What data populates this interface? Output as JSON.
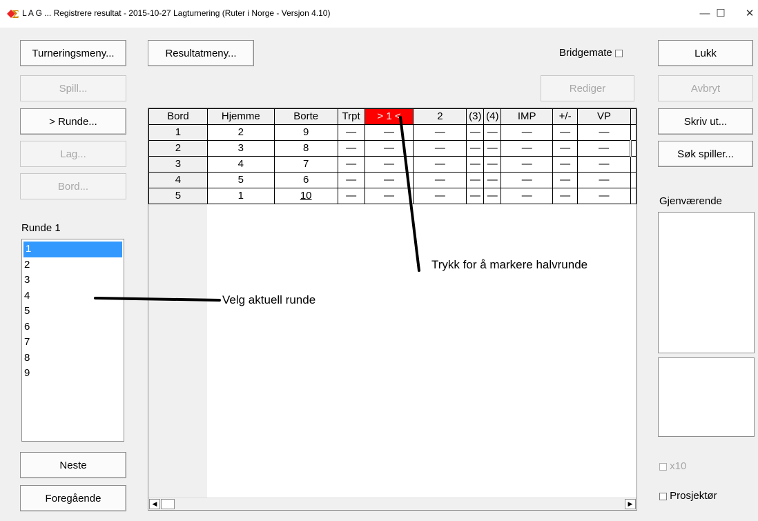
{
  "window": {
    "title": "L A G ... Registrere resultat - 2015-10-27  Lagturnering  (Ruter i Norge - Versjon 4.10)",
    "controls": {
      "minimize": "—",
      "maximize": "☐",
      "close": "✕"
    }
  },
  "toolbar": {
    "turneringsmeny": "Turneringsmeny...",
    "resultatmeny": "Resultatmeny...",
    "bridgemate_label": "Bridgemate",
    "lukk": "Lukk",
    "rediger": "Rediger",
    "avbryt": "Avbryt"
  },
  "left": {
    "spill": "Spill...",
    "runde": ">  Runde...",
    "lag": "Lag...",
    "bord": "Bord...",
    "round_label": "Runde 1",
    "rounds": [
      "1",
      "2",
      "3",
      "4",
      "5",
      "6",
      "7",
      "8",
      "9"
    ],
    "selected_round": "1",
    "neste": "Neste",
    "forrige": "Foregående"
  },
  "right": {
    "skriv_ut": "Skriv ut...",
    "sok_spiller": "Søk spiller...",
    "gjenvaerende": "Gjenværende",
    "x10": "x10",
    "prosjektor": "Prosjektør"
  },
  "table": {
    "headers": [
      "Bord",
      "Hjemme",
      "Borte",
      "Trpt",
      "> 1 <",
      "2",
      "(3)",
      "(4)",
      "IMP",
      "+/-",
      "VP"
    ],
    "rows": [
      [
        "1",
        "2",
        "9",
        "—",
        "—",
        "—",
        "—",
        "—",
        "—",
        "—",
        "—"
      ],
      [
        "2",
        "3",
        "8",
        "—",
        "—",
        "—",
        "—",
        "—",
        "—",
        "—",
        "—"
      ],
      [
        "3",
        "4",
        "7",
        "—",
        "—",
        "—",
        "—",
        "—",
        "—",
        "—",
        "—"
      ],
      [
        "4",
        "5",
        "6",
        "—",
        "—",
        "—",
        "—",
        "—",
        "—",
        "—",
        "—"
      ],
      [
        "5",
        "1",
        "10",
        "—",
        "—",
        "—",
        "—",
        "—",
        "—",
        "—",
        "—"
      ]
    ],
    "highlight_color": "#ff0000"
  },
  "annotations": {
    "halvrunde": "Trykk for å markere halvrunde",
    "aktuell_runde": "Velg aktuell runde"
  },
  "colors": {
    "selection": "#3399ff",
    "background": "#f0f0f0"
  }
}
